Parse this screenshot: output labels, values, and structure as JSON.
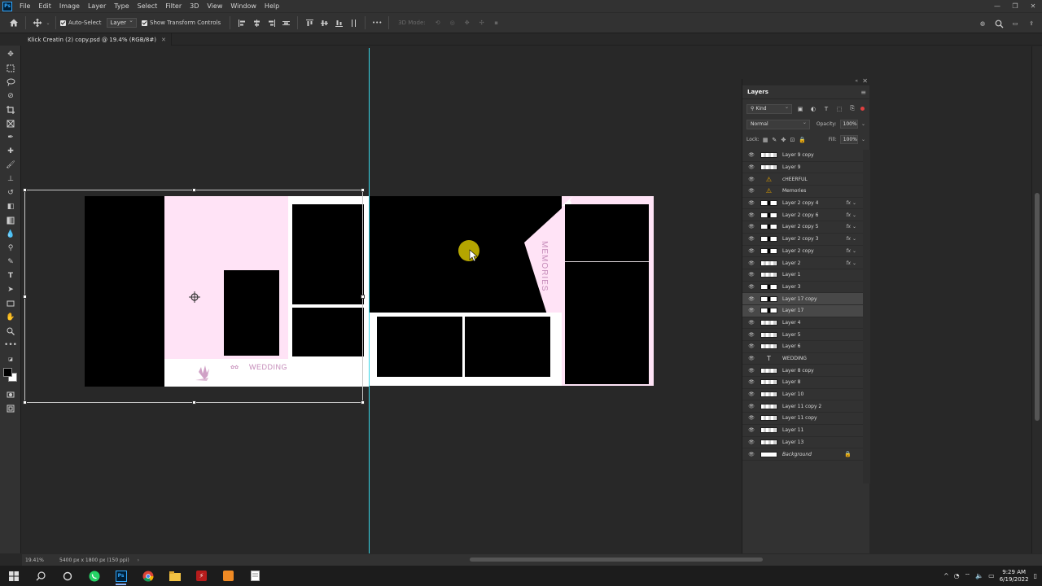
{
  "menubar": {
    "logo": "Ps",
    "items": [
      "File",
      "Edit",
      "Image",
      "Layer",
      "Type",
      "Select",
      "Filter",
      "3D",
      "View",
      "Window",
      "Help"
    ]
  },
  "options_bar": {
    "auto_select_label": "Auto-Select",
    "auto_select_target": "Layer",
    "show_transform_label": "Show Transform Controls",
    "mode_3d_label": "3D Mode:"
  },
  "document_tab": {
    "title": "Klick Creatin (2) copy.psd @ 19.4% (RGB/8#)"
  },
  "canvas": {
    "wedding_text": "WEDDING",
    "memories_text": "MEMORIES",
    "colors": {
      "pink": "#ffe3f6",
      "accent_text": "#c48ab8",
      "guide": "#39d6e6"
    }
  },
  "layers_panel": {
    "title": "Layers",
    "filter_kind": "Kind",
    "blend_mode": "Normal",
    "opacity_label": "Opacity:",
    "opacity_value": "100%",
    "lock_label": "Lock:",
    "fill_label": "Fill:",
    "fill_value": "100%",
    "layers": [
      {
        "name": "Layer 9 copy",
        "kind": "pixel",
        "fx": false
      },
      {
        "name": "Layer 9",
        "kind": "pixel",
        "fx": false
      },
      {
        "name": "cHEERFUL",
        "kind": "smart",
        "fx": false
      },
      {
        "name": "Memories",
        "kind": "smart",
        "fx": false
      },
      {
        "name": "Layer 2 copy 4",
        "kind": "pixel",
        "fx": true
      },
      {
        "name": "Layer 2 copy 6",
        "kind": "pixel",
        "fx": true
      },
      {
        "name": "Layer 2 copy 5",
        "kind": "pixel",
        "fx": true
      },
      {
        "name": "Layer 2 copy 3",
        "kind": "pixel",
        "fx": true
      },
      {
        "name": "Layer 2 copy",
        "kind": "pixel",
        "fx": true
      },
      {
        "name": "Layer 2",
        "kind": "pixel",
        "fx": true
      },
      {
        "name": "Layer 1",
        "kind": "pixel",
        "fx": false
      },
      {
        "name": "Layer 3",
        "kind": "pixel",
        "fx": false
      },
      {
        "name": "Layer 17 copy",
        "kind": "pixel",
        "fx": false,
        "selected": true
      },
      {
        "name": "Layer 17",
        "kind": "pixel",
        "fx": false,
        "selected": true
      },
      {
        "name": "Layer 4",
        "kind": "pixel",
        "fx": false
      },
      {
        "name": "Layer 5",
        "kind": "pixel",
        "fx": false
      },
      {
        "name": "Layer 6",
        "kind": "pixel",
        "fx": false
      },
      {
        "name": "WEDDING",
        "kind": "type",
        "fx": false
      },
      {
        "name": "Layer 8 copy",
        "kind": "pixel",
        "fx": false
      },
      {
        "name": "Layer 8",
        "kind": "pixel",
        "fx": false
      },
      {
        "name": "Layer 10",
        "kind": "pixel",
        "fx": false
      },
      {
        "name": "Layer 11 copy 2",
        "kind": "pixel",
        "fx": false
      },
      {
        "name": "Layer 11 copy",
        "kind": "pixel",
        "fx": false
      },
      {
        "name": "Layer 11",
        "kind": "pixel",
        "fx": false
      },
      {
        "name": "Layer 13",
        "kind": "pixel",
        "fx": false
      },
      {
        "name": "Background",
        "kind": "background",
        "fx": false,
        "locked": true
      }
    ]
  },
  "status": {
    "zoom": "19.41%",
    "doc_info": "5400 px x 1800 px (150 ppi)"
  },
  "taskbar": {
    "time": "9:29 AM",
    "date": "6/19/2022"
  }
}
